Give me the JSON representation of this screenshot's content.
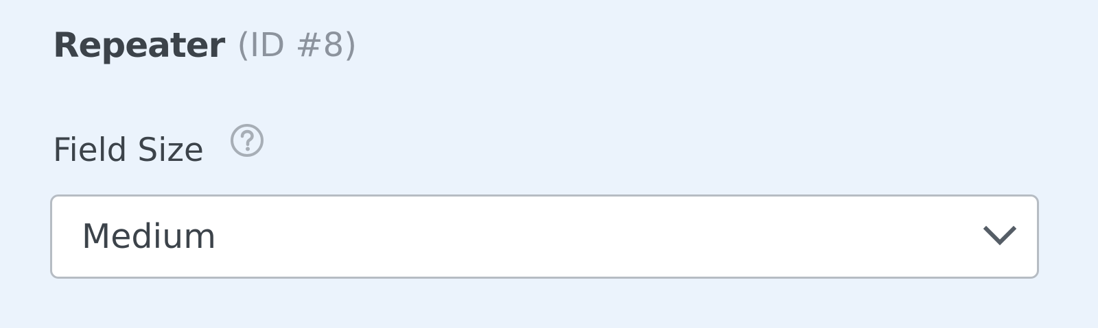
{
  "field": {
    "title": "Repeater",
    "id_text": "(ID #8)"
  },
  "field_size": {
    "label": "Field Size",
    "help_icon": "question-circle-icon",
    "selected_value": "Medium",
    "dropdown_icon": "chevron-down-icon"
  },
  "colors": {
    "background": "#ebf3fc",
    "text": "#3c434a",
    "muted_text": "#8c939d",
    "border": "#b6bcc3",
    "icon": "#a7aeb6"
  }
}
